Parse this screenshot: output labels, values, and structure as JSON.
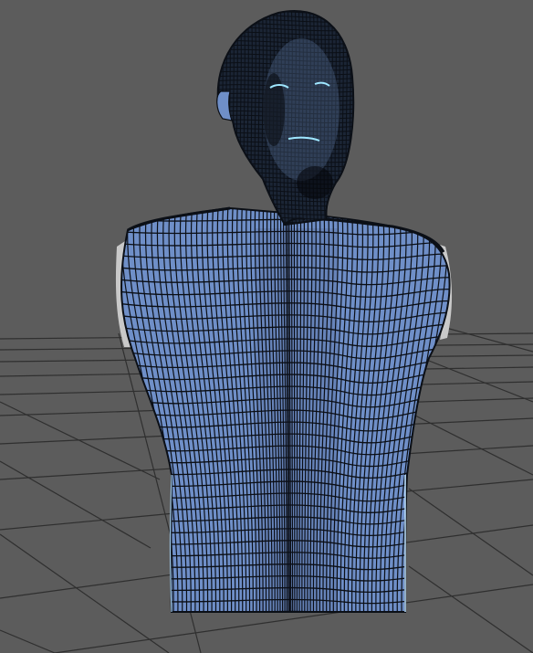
{
  "viewport": {
    "display_mode": "wireframe-on-shaded",
    "background_color": "#5c5c5c",
    "grid_color": "#2f2f2f",
    "model": {
      "name": "human-bust",
      "surface_color": "#6f8fc8",
      "wire_color": "#0b0f16",
      "rim_highlight_color": "#bfe3ff",
      "eye_highlight_color": "#9fe7ff"
    }
  }
}
